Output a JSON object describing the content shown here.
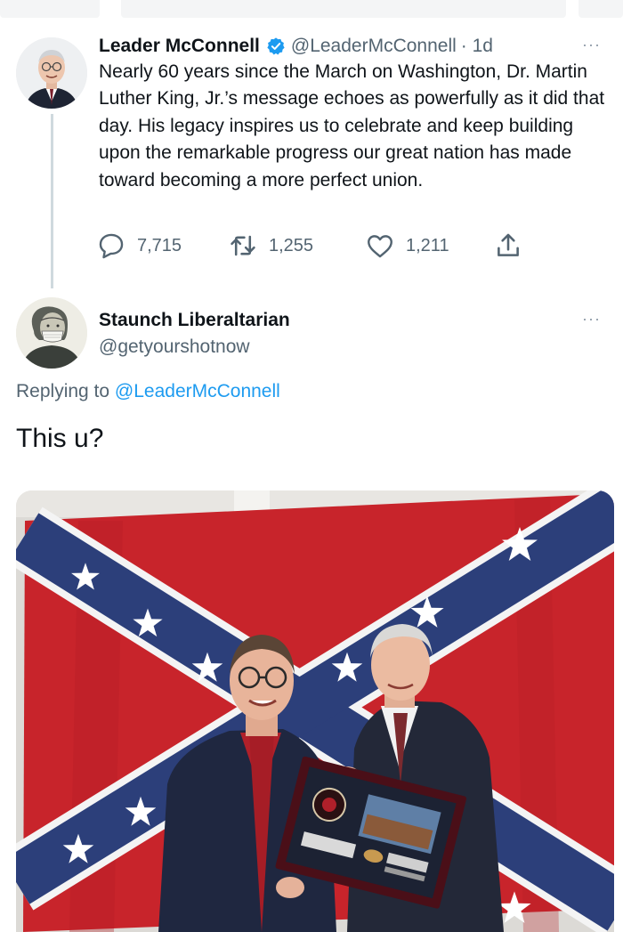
{
  "tweet": {
    "author_name": "Leader McConnell",
    "handle": "@LeaderMcConnell",
    "time": "· 1d",
    "more": "···",
    "text": "Nearly 60 years since the March on Washington, Dr. Martin Luther King, Jr.’s message echoes as powerfully as it did that day. His legacy inspires us to celebrate and keep building upon the remarkable progress our great nation has made toward becoming a more perfect union.",
    "replies": "7,715",
    "retweets": "1,255",
    "likes": "1,211"
  },
  "reply": {
    "author_name": "Staunch Liberaltarian",
    "handle": "@getyourshotnow",
    "more": "···",
    "replying_prefix": "Replying to",
    "replying_to": "@LeaderMcConnell",
    "text": "This u?",
    "image_icon": "photo-two-men-with-framed-award-in-front-of-confederate-flag"
  },
  "colors": {
    "verified": "#1d9bf0",
    "link": "#1d9bf0",
    "secondary_text": "#536471",
    "flag_red": "#c8242b",
    "flag_blue": "#2c3f7a"
  }
}
